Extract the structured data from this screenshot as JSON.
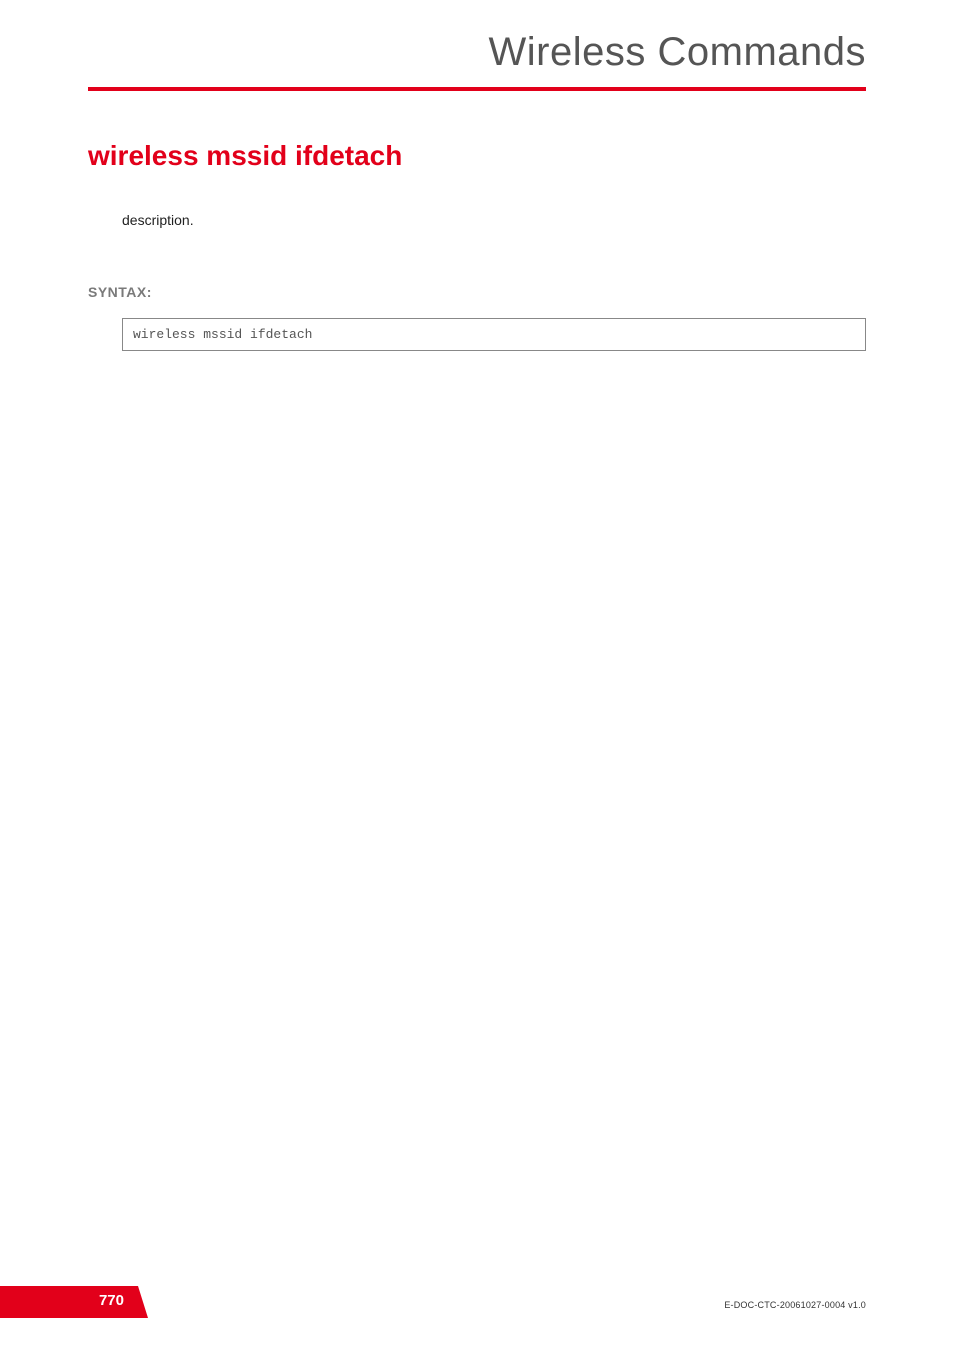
{
  "header": {
    "title": "Wireless Commands"
  },
  "command": {
    "title": "wireless mssid ifdetach",
    "description": "description."
  },
  "syntax": {
    "label": "SYNTAX:",
    "code": "wireless mssid ifdetach"
  },
  "footer": {
    "page_number": "770",
    "doc_id": "E-DOC-CTC-20061027-0004 v1.0"
  }
}
